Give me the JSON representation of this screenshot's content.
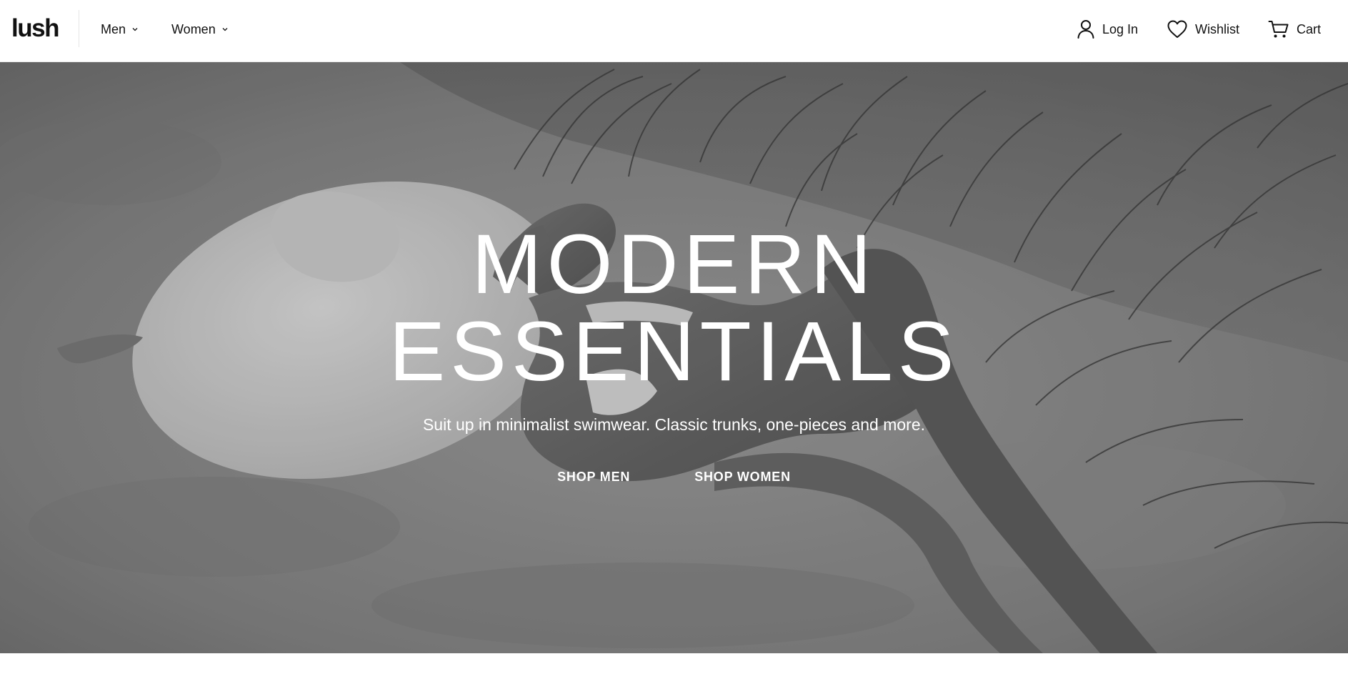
{
  "header": {
    "logo": "lush",
    "nav": [
      {
        "label": "Men"
      },
      {
        "label": "Women"
      }
    ],
    "actions": {
      "login": "Log In",
      "wishlist": "Wishlist",
      "cart": "Cart"
    }
  },
  "hero": {
    "title_line1": "MODERN",
    "title_line2": "ESSENTIALS",
    "subtitle": "Suit up in minimalist swimwear. Classic trunks, one-pieces and more.",
    "cta_men": "SHOP MEN",
    "cta_women": "SHOP WOMEN",
    "image": "black-and-white beach photo: model lying on sand with wide-brim sun hat, dune grass"
  },
  "icons": {
    "user": "user-icon",
    "heart": "heart-icon",
    "cart": "cart-icon",
    "chevron": "chevron-down-icon"
  },
  "colors": {
    "text": "#111111",
    "hero_text": "#ffffff",
    "background": "#ffffff"
  }
}
